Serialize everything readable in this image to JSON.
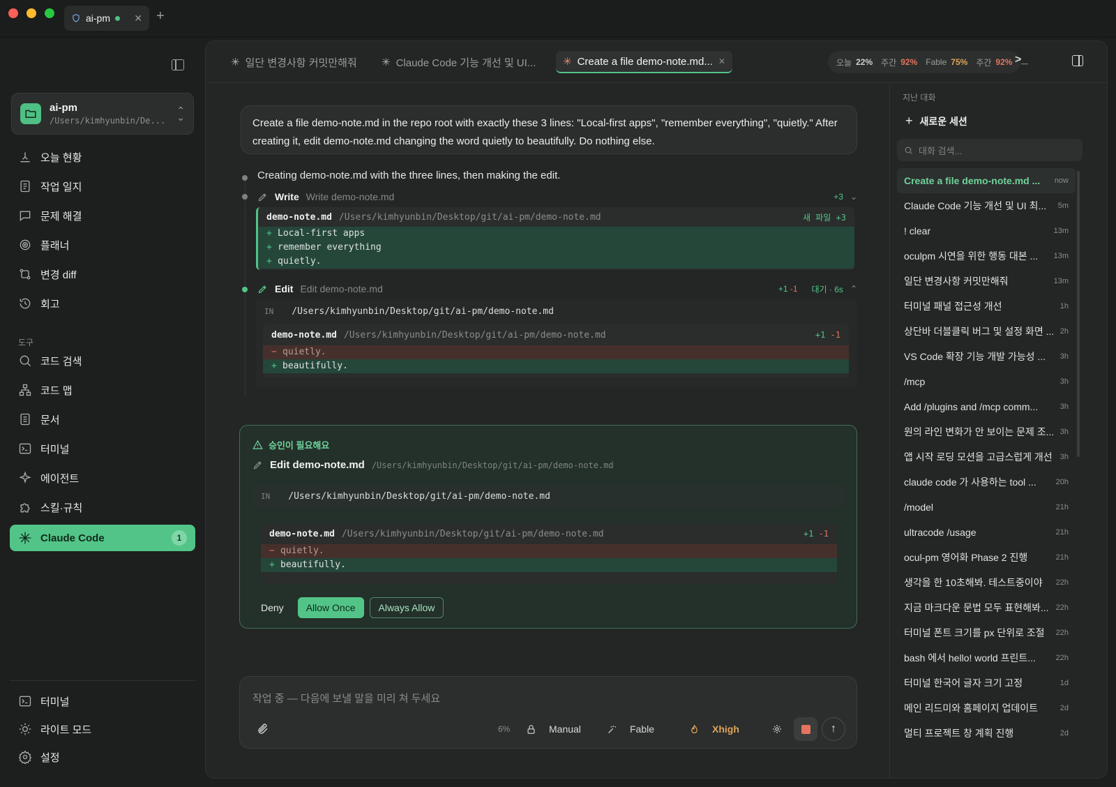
{
  "window": {
    "tab_title": "ai-pm"
  },
  "sidebar": {
    "project": {
      "name": "ai-pm",
      "path": "/Users/kimhyunbin/De..."
    },
    "nav": [
      {
        "label": "오늘 현황"
      },
      {
        "label": "작업 일지"
      },
      {
        "label": "문제 해결"
      },
      {
        "label": "플래너"
      },
      {
        "label": "변경 diff"
      },
      {
        "label": "회고"
      }
    ],
    "tools_label": "도구",
    "tools": [
      {
        "label": "코드 검색"
      },
      {
        "label": "코드 맵"
      },
      {
        "label": "문서"
      },
      {
        "label": "터미널"
      },
      {
        "label": "에이전트"
      },
      {
        "label": "스킬·규칙"
      }
    ],
    "claude": {
      "label": "Claude Code",
      "badge": "1"
    },
    "bottom": [
      {
        "label": "터미널"
      },
      {
        "label": "라이트 모드"
      },
      {
        "label": "설정"
      }
    ]
  },
  "tabs": [
    {
      "label": "일단 변경사항 커밋만해줘"
    },
    {
      "label": "Claude Code 기능 개선 및 UI..."
    },
    {
      "label": "Create a file demo-note.md..."
    }
  ],
  "usage": {
    "today_label": "오늘",
    "today": "22%",
    "week_label": "주간",
    "week": "92%",
    "fable_label": "Fable",
    "fable": "75%",
    "week2_label": "주간",
    "week2": "92%"
  },
  "chat": {
    "prompt": "Create a file demo-note.md in the repo root with exactly these 3 lines: \"Local-first apps\", \"remember everything\", \"quietly.\" After creating it, edit demo-note.md changing the word quietly to beautifully. Do nothing else.",
    "assistant": "Creating demo-note.md with the three lines, then making the edit.",
    "write": {
      "name": "Write",
      "desc": "Write demo-note.md",
      "stat": "+3",
      "file": "demo-note.md",
      "path": "/Users/kimhyunbin/Desktop/git/ai-pm/demo-note.md",
      "badge": "새 파일 +3",
      "lines": [
        "Local-first apps",
        "remember everything",
        "quietly."
      ]
    },
    "edit": {
      "name": "Edit",
      "desc": "Edit demo-note.md",
      "add": "+1",
      "del": "-1",
      "status": "대기 · 6s",
      "in_tag": "IN",
      "in_path": "/Users/kimhyunbin/Desktop/git/ai-pm/demo-note.md",
      "file": "demo-note.md",
      "path": "/Users/kimhyunbin/Desktop/git/ai-pm/demo-note.md",
      "del_line": "quietly.",
      "add_line": "beautifully."
    }
  },
  "approval": {
    "title": "승인이 필요해요",
    "tool": "Edit demo-note.md",
    "tool_path": "/Users/kimhyunbin/Desktop/git/ai-pm/demo-note.md",
    "in_tag": "IN",
    "in_path": "/Users/kimhyunbin/Desktop/git/ai-pm/demo-note.md",
    "file": "demo-note.md",
    "path": "/Users/kimhyunbin/Desktop/git/ai-pm/demo-note.md",
    "add": "+1",
    "del": "-1",
    "del_line": "quietly.",
    "add_line": "beautifully.",
    "deny": "Deny",
    "allow_once": "Allow Once",
    "always_allow": "Always Allow"
  },
  "composer": {
    "placeholder": "작업 중 — 다음에 보낼 말을 미리 쳐 두세요",
    "context": "6%",
    "mode": "Manual",
    "model": "Fable",
    "effort": "Xhigh"
  },
  "history": {
    "title": "지난 대화",
    "new_session": "새로운 세션",
    "search_placeholder": "대화 검색...",
    "items": [
      {
        "title": "Create a file demo-note.md ...",
        "when": "now"
      },
      {
        "title": "Claude Code 기능 개선 및 UI 최...",
        "when": "5m"
      },
      {
        "title": "! clear",
        "when": "13m"
      },
      {
        "title": "oculpm 시연을 위한 행동 대본 ...",
        "when": "13m"
      },
      {
        "title": "일단 변경사항 커밋만해줘",
        "when": "13m"
      },
      {
        "title": "터미널 패널 접근성 개선",
        "when": "1h"
      },
      {
        "title": "상단바 더블클릭 버그 및 설정 화면 ...",
        "when": "2h"
      },
      {
        "title": "VS Code 확장 기능 개발 가능성 ...",
        "when": "3h"
      },
      {
        "title": "/mcp",
        "when": "3h"
      },
      {
        "title": "Add /plugins and /mcp comm...",
        "when": "3h"
      },
      {
        "title": "원의 라인 변화가 안 보이는 문제 조...",
        "when": "3h"
      },
      {
        "title": "앱 시작 로딩 모션을 고급스럽게 개선",
        "when": "3h"
      },
      {
        "title": "claude code 가 사용하는 tool ...",
        "when": "20h"
      },
      {
        "title": "/model",
        "when": "21h"
      },
      {
        "title": "ultracode /usage",
        "when": "21h"
      },
      {
        "title": "ocul-pm 영어화 Phase 2 진행",
        "when": "21h"
      },
      {
        "title": "생각을 한 10초해봐. 테스트중이야",
        "when": "22h"
      },
      {
        "title": "지금 마크다운 문법 모두 표현해봐...",
        "when": "22h"
      },
      {
        "title": "터미널 폰트 크기를 px 단위로 조절",
        "when": "22h"
      },
      {
        "title": "bash 에서 hello! world 프린트...",
        "when": "22h"
      },
      {
        "title": "터미널 한국어 글자 크기 고정",
        "when": "1d"
      },
      {
        "title": "메인 리드미와 홈페이지 업데이트",
        "when": "2d"
      },
      {
        "title": "멀티 프로젝트 창 계획 진행",
        "when": "2d"
      }
    ]
  },
  "colors": {
    "accent": "#53c488",
    "danger": "#e4745e",
    "background": "#1d1f1e"
  }
}
